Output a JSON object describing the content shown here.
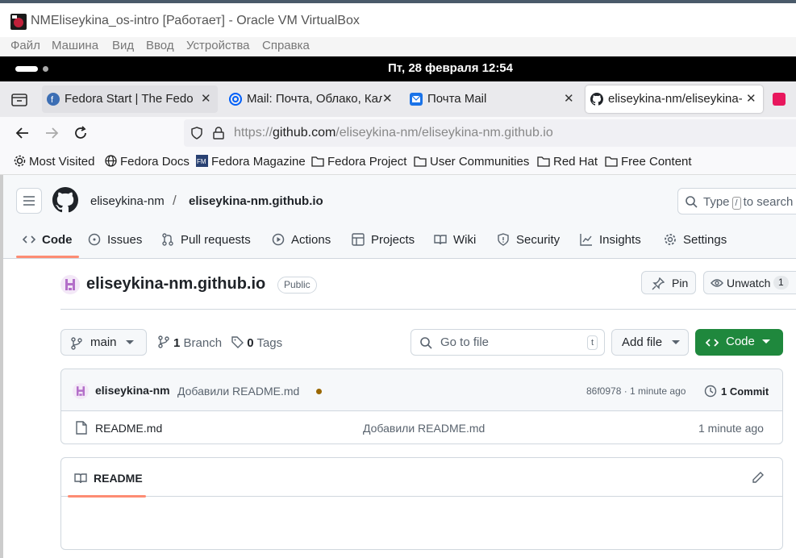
{
  "vbox": {
    "title": "NMEliseykina_os-intro [Работает] - Oracle VM VirtualBox",
    "menu": [
      "Файл",
      "Машина",
      "Вид",
      "Ввод",
      "Устройства",
      "Справка"
    ]
  },
  "gnome": {
    "clock": "Пт, 28 февраля  12:54"
  },
  "tabs": [
    {
      "label": "Fedora Start | The Fedora"
    },
    {
      "label": "Mail: Почта, Облако, Кал"
    },
    {
      "label": "Почта Mail"
    },
    {
      "label": "eliseykina-nm/eliseykina-"
    }
  ],
  "tab_close": "✕",
  "url": {
    "prefix": "https://",
    "host": "github.com",
    "path": "/eliseykina-nm/eliseykina-nm.github.io"
  },
  "bookmarks": [
    "Most Visited",
    "Fedora Docs",
    "Fedora Magazine",
    "Fedora Project",
    "User Communities",
    "Red Hat",
    "Free Content"
  ],
  "github": {
    "owner": "eliseykina-nm",
    "slash": "/",
    "repo": "eliseykina-nm.github.io",
    "search_prefix": "Type",
    "search_key": "/",
    "search_suffix": "to search",
    "repo_tabs": [
      "Code",
      "Issues",
      "Pull requests",
      "Actions",
      "Projects",
      "Wiki",
      "Security",
      "Insights",
      "Settings"
    ],
    "visibility": "Public",
    "pin": "Pin",
    "unwatch": "Unwatch",
    "watch_count": "1",
    "branch": "main",
    "branch_count": "1",
    "branch_label": "Branch",
    "tag_count": "0",
    "tag_label": "Tags",
    "goto_placeholder": "Go to file",
    "goto_key": "t",
    "add_file": "Add file",
    "code_button": "Code",
    "commit": {
      "author": "eliseykina-nm",
      "message": "Добавили README.md",
      "hash_time": "86f0978 · 1 minute ago",
      "count": "1 Commit"
    },
    "files": [
      {
        "name": "README.md",
        "message": "Добавили README.md",
        "time": "1 minute ago"
      }
    ],
    "readme_label": "README"
  }
}
